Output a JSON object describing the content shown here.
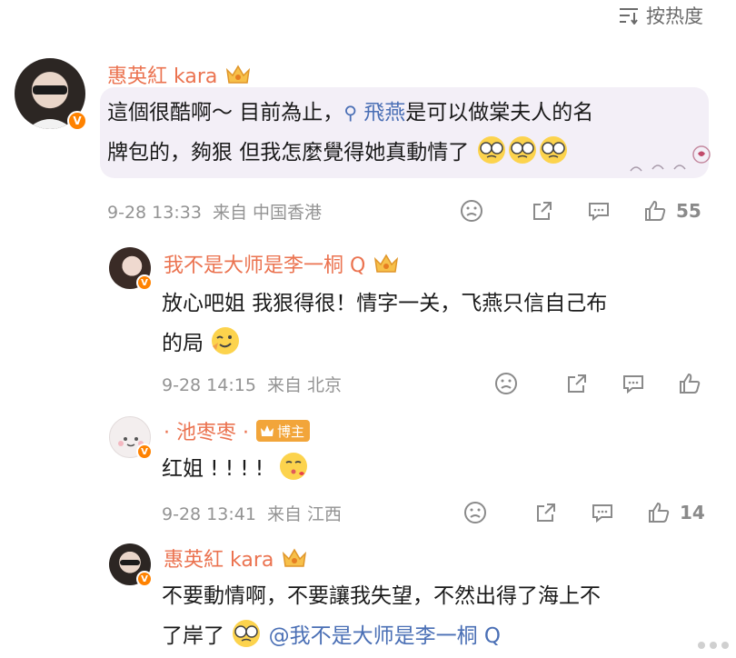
{
  "sort": {
    "label": "按热度",
    "icon": "sort-icon"
  },
  "comments": [
    {
      "username": "惠英紅 kara",
      "badge": "crown-vip-icon",
      "text_line1": "這個很酷啊～ 目前為止，",
      "mention": "飛燕",
      "text_line1_rest": "是可以做棠夫人的名",
      "text_line2": "牌包的，夠狠 但我怎麼覺得她真動情了",
      "emojis": [
        "glasses-face-emoji",
        "glasses-face-emoji",
        "glasses-face-emoji"
      ],
      "time": "9-28 13:33",
      "source": "来自 中国香港",
      "likes": "55"
    },
    {
      "username": "我不是大师是李一桐 Q",
      "badge": "crown-vip-icon",
      "text_line1": "放心吧姐 我狠得很！情字一关，飞燕只信自己布",
      "text_line2": "的局",
      "emojis": [
        "wink-face-emoji"
      ],
      "time": "9-28 14:15",
      "source": "来自 北京",
      "likes": ""
    },
    {
      "username": "· 池枣枣 ·",
      "badge": "crown-vip-icon",
      "tag": "博主",
      "text_line1": "红姐 ! ! ! !",
      "emojis": [
        "kiss-face-emoji"
      ],
      "time": "9-28 13:41",
      "source": "来自 江西",
      "likes": "14"
    },
    {
      "username": "惠英紅 kara",
      "badge": "crown-vip-icon",
      "text_line1": "不要動情啊，不要讓我失望，不然出得了海上不",
      "text_line2": "了岸了",
      "mention": "@我不是大师是李一桐 Q",
      "emojis": [
        "glasses-face-emoji"
      ]
    }
  ],
  "colors": {
    "username": "#eb7350",
    "link": "#4a6fb5",
    "meta": "#939393",
    "vbadge": "#ff8200"
  }
}
